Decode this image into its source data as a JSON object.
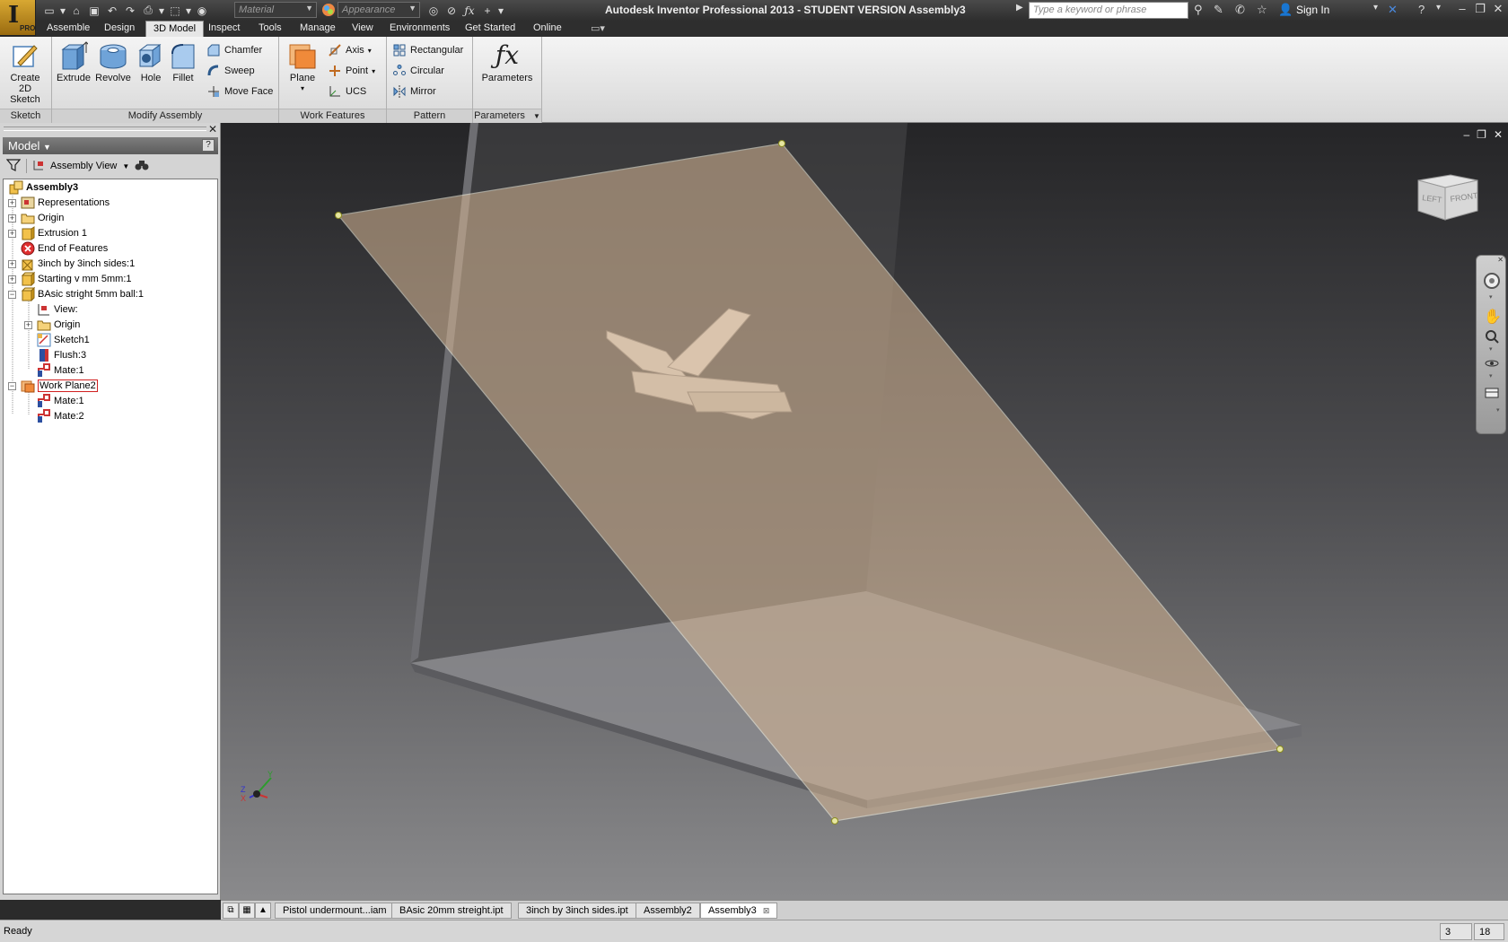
{
  "app": {
    "title": "Autodesk Inventor Professional 2013 - STUDENT VERSION   Assembly3",
    "app_button_badge": "PRO",
    "material_placeholder": "Material",
    "appearance_placeholder": "Appearance",
    "search_placeholder": "Type a keyword or phrase",
    "sign_in": "Sign In"
  },
  "ribbon_tabs": [
    "Assemble",
    "Design",
    "3D Model",
    "Inspect",
    "Tools",
    "Manage",
    "View",
    "Environments",
    "Get Started",
    "Online"
  ],
  "active_tab": "3D Model",
  "ribbon": {
    "sketch": {
      "title": "Sketch",
      "create_2d_sketch": "Create\n2D Sketch"
    },
    "modify": {
      "title": "Modify Assembly",
      "extrude": "Extrude",
      "revolve": "Revolve",
      "hole": "Hole",
      "fillet": "Fillet",
      "chamfer": "Chamfer",
      "sweep": "Sweep",
      "move_face": "Move Face"
    },
    "work_features": {
      "title": "Work Features",
      "plane": "Plane",
      "axis": "Axis",
      "point": "Point",
      "ucs": "UCS"
    },
    "pattern": {
      "title": "Pattern",
      "rectangular": "Rectangular",
      "circular": "Circular",
      "mirror": "Mirror"
    },
    "parameters": {
      "title": "Parameters",
      "parameters": "Parameters"
    }
  },
  "browser": {
    "header": "Model",
    "view_selector": "Assembly View",
    "tree": [
      {
        "label": "Assembly3",
        "level": 0
      },
      {
        "label": "Representations",
        "level": 0
      },
      {
        "label": "Origin",
        "level": 0
      },
      {
        "label": "Extrusion 1",
        "level": 0
      },
      {
        "label": "End of Features",
        "level": 0
      },
      {
        "label": "3inch by 3inch sides:1",
        "level": 0
      },
      {
        "label": "Starting v mm 5mm:1",
        "level": 0
      },
      {
        "label": "BAsic stright 5mm ball:1",
        "level": 0
      },
      {
        "label": "View:",
        "level": 1
      },
      {
        "label": "Origin",
        "level": 1
      },
      {
        "label": "Sketch1",
        "level": 1
      },
      {
        "label": "Flush:3",
        "level": 1
      },
      {
        "label": "Mate:1",
        "level": 1
      },
      {
        "label": "Work Plane2",
        "level": 0
      },
      {
        "label": "Mate:1",
        "level": 1
      },
      {
        "label": "Mate:2",
        "level": 1
      }
    ]
  },
  "viewcube": {
    "left": "LEFT",
    "front": "FRONT"
  },
  "triad": {
    "x": "X",
    "y": "Y",
    "z": "Z"
  },
  "doc_tabs": [
    "Pistol undermount...iam",
    "BAsic 20mm streight.ipt",
    "3inch by 3inch sides.ipt",
    "Assembly2",
    "Assembly3"
  ],
  "active_doc": "Assembly3",
  "status": {
    "text": "Ready",
    "cell1": "3",
    "cell2": "18"
  }
}
